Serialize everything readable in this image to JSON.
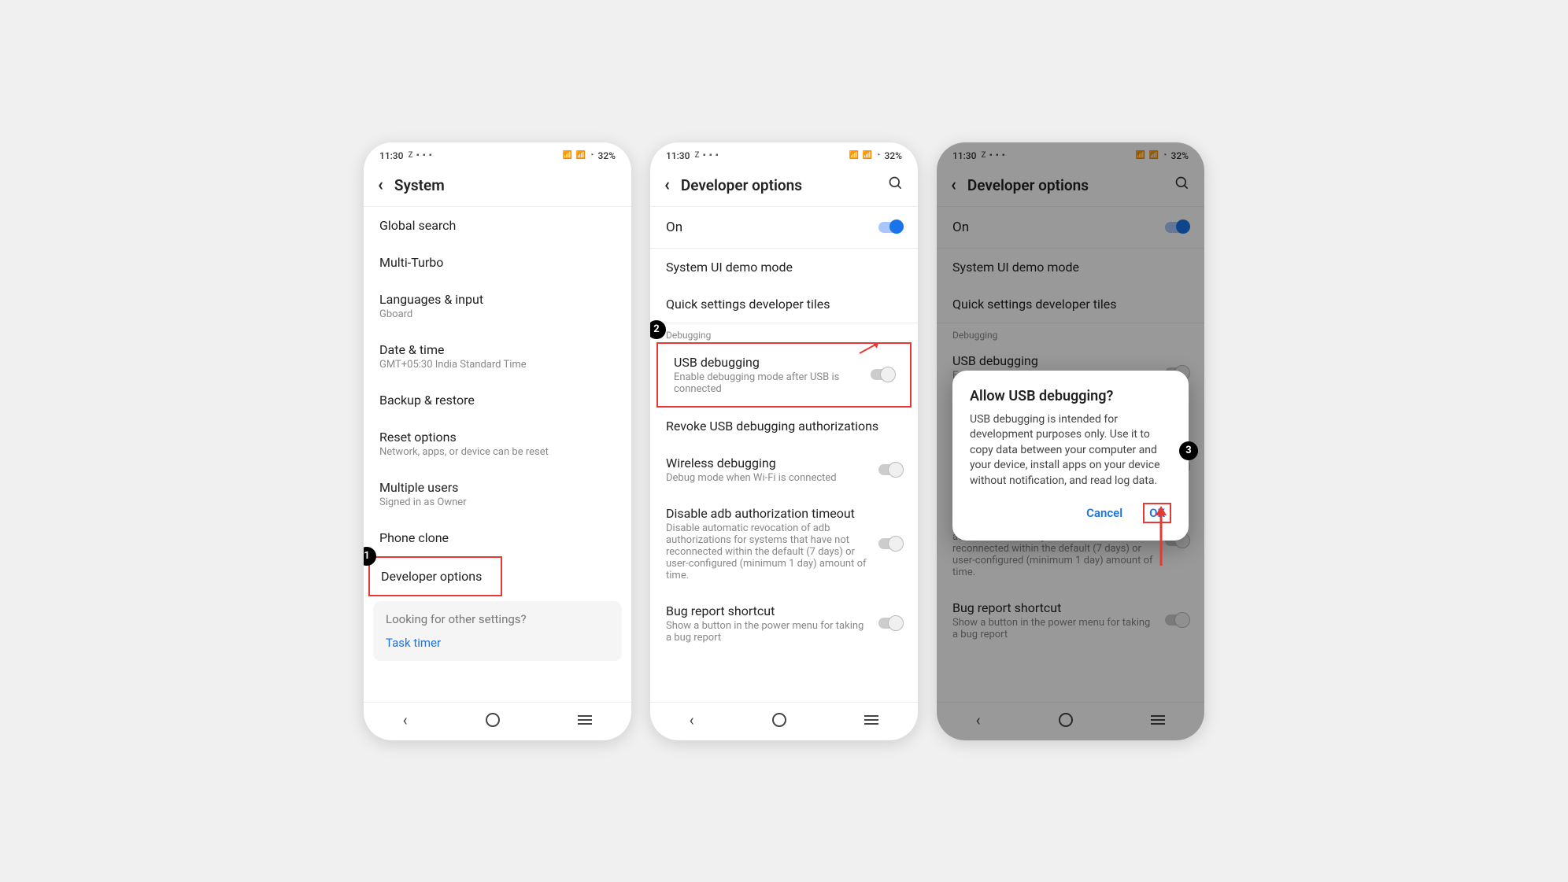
{
  "status": {
    "time": "11:30",
    "battery": "32%",
    "icons_left": "Z ▪ ▪ ▪",
    "icons_right": "📶 📶 ◔"
  },
  "screen1": {
    "title": "System",
    "items": [
      {
        "title": "Global search"
      },
      {
        "title": "Multi-Turbo"
      },
      {
        "title": "Languages & input",
        "sub": "Gboard"
      },
      {
        "title": "Date & time",
        "sub": "GMT+05:30 India Standard Time"
      },
      {
        "title": "Backup & restore"
      },
      {
        "title": "Reset options",
        "sub": "Network, apps, or device can be reset"
      },
      {
        "title": "Multiple users",
        "sub": "Signed in as Owner"
      },
      {
        "title": "Phone clone"
      },
      {
        "title": "Developer options"
      }
    ],
    "search_help": "Looking for other settings?",
    "search_link": "Task timer"
  },
  "screen2": {
    "title": "Developer options",
    "on_label": "On",
    "items": {
      "demo": "System UI demo mode",
      "tiles": "Quick settings developer tiles",
      "section": "Debugging",
      "usb_title": "USB debugging",
      "usb_sub": "Enable debugging mode after USB is connected",
      "revoke": "Revoke USB debugging authorizations",
      "wireless_title": "Wireless debugging",
      "wireless_sub": "Debug mode when Wi-Fi is connected",
      "disable_title": "Disable adb authorization timeout",
      "disable_sub": "Disable automatic revocation of adb authorizations for systems that have not reconnected within the default (7 days) or user-configured (minimum 1 day) amount of time.",
      "bug_title": "Bug report shortcut",
      "bug_sub": "Show a button in the power menu for taking a bug report"
    }
  },
  "screen3": {
    "dialog_title": "Allow USB debugging?",
    "dialog_body": "USB debugging is intended for development purposes only. Use it to copy data between your computer and your device, install apps on your device without notification, and read log data.",
    "cancel": "Cancel",
    "ok": "OK"
  },
  "badges": {
    "one": "1",
    "two": "2",
    "three": "3"
  }
}
